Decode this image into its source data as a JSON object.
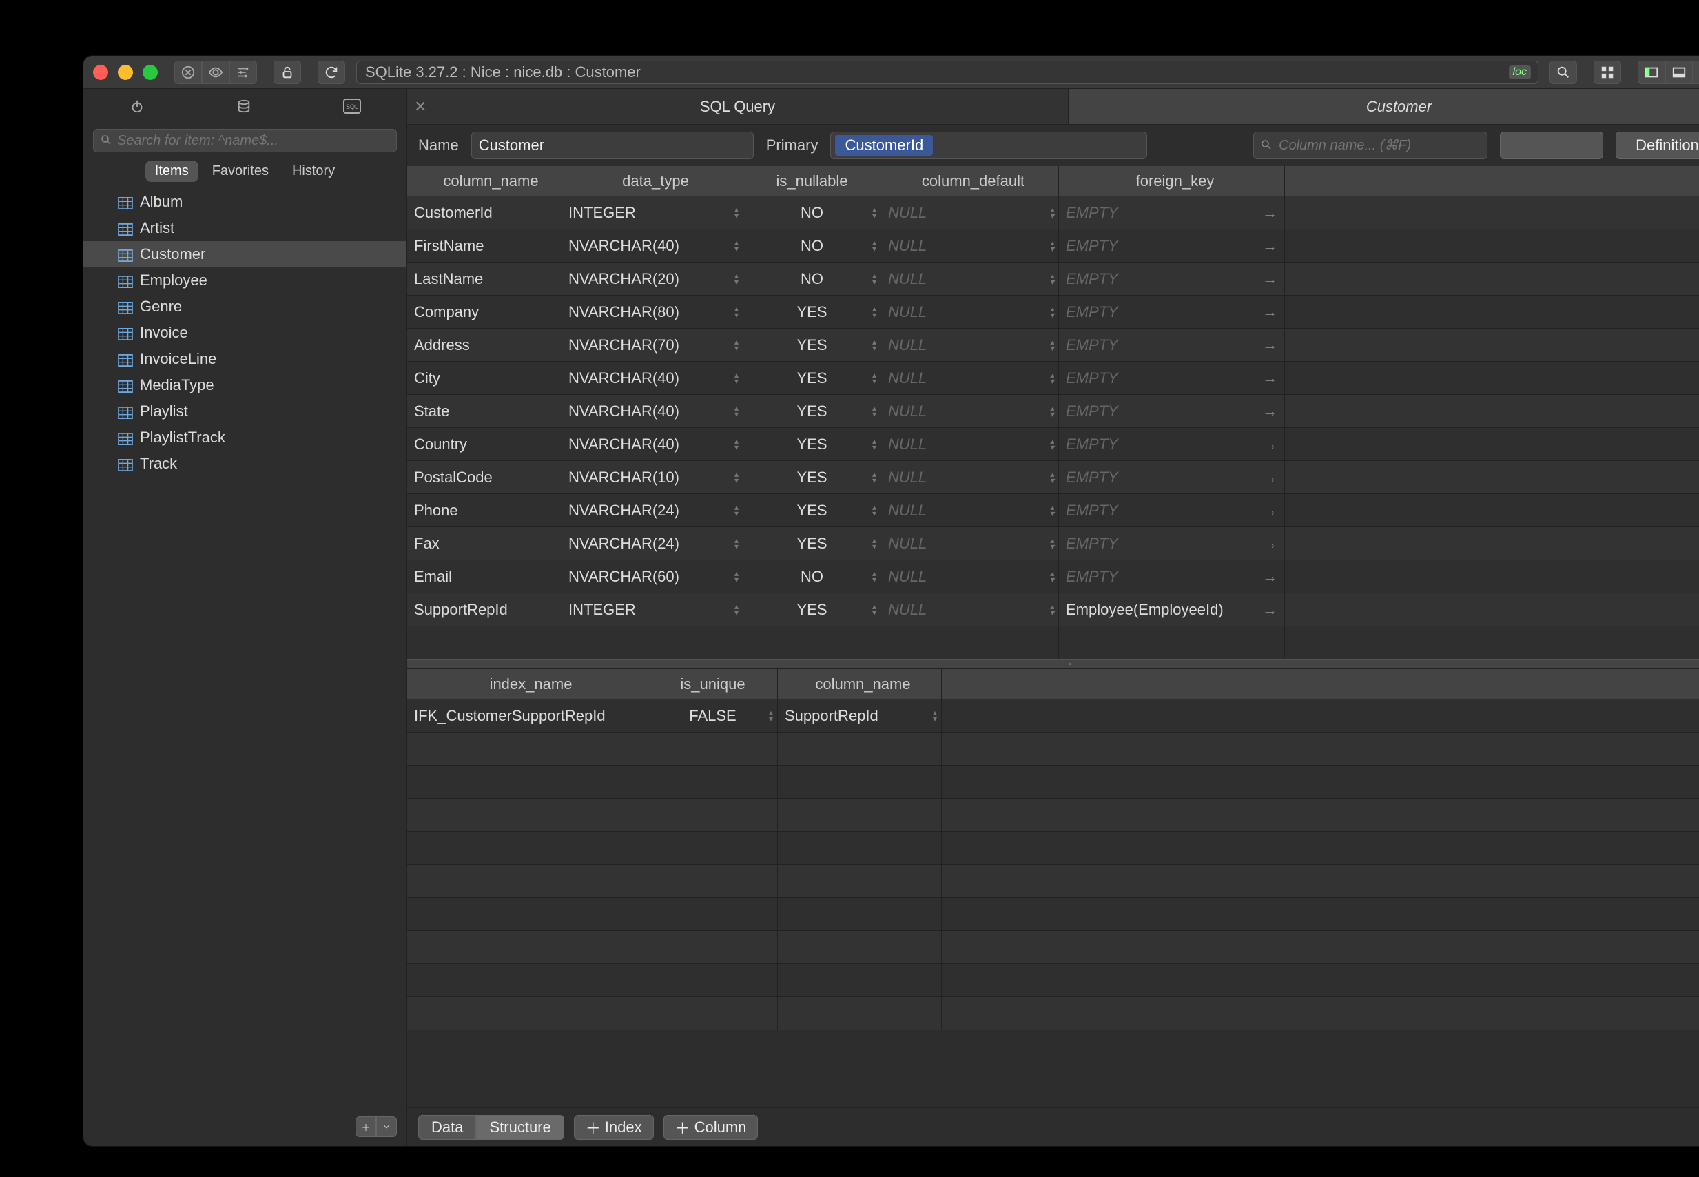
{
  "titlebar": {
    "path": "SQLite 3.27.2 : Nice : nice.db : Customer",
    "loc_tag": "loc"
  },
  "main_tabs": [
    {
      "label": "SQL Query",
      "closable": true,
      "active": false
    },
    {
      "label": "Customer",
      "closable": false,
      "active": true
    }
  ],
  "sidebar": {
    "search_placeholder": "Search for item: ^name$...",
    "filter_tabs": [
      "Items",
      "Favorites",
      "History"
    ],
    "filter_active": 0,
    "items": [
      "Album",
      "Artist",
      "Customer",
      "Employee",
      "Genre",
      "Invoice",
      "InvoiceLine",
      "MediaType",
      "Playlist",
      "PlaylistTrack",
      "Track"
    ],
    "selected": "Customer"
  },
  "table_editor": {
    "name_label": "Name",
    "name_value": "Customer",
    "primary_label": "Primary",
    "primary_key": "CustomerId",
    "column_search_placeholder": "Column name... (⌘F)",
    "definition_label": "Definition"
  },
  "columns_header": [
    "column_name",
    "data_type",
    "is_nullable",
    "column_default",
    "foreign_key"
  ],
  "columns": [
    {
      "name": "CustomerId",
      "type": "INTEGER",
      "nullable": "NO",
      "default": "NULL",
      "fk": "EMPTY",
      "fk_ghost": true
    },
    {
      "name": "FirstName",
      "type": "NVARCHAR(40)",
      "nullable": "NO",
      "default": "NULL",
      "fk": "EMPTY",
      "fk_ghost": true
    },
    {
      "name": "LastName",
      "type": "NVARCHAR(20)",
      "nullable": "NO",
      "default": "NULL",
      "fk": "EMPTY",
      "fk_ghost": true
    },
    {
      "name": "Company",
      "type": "NVARCHAR(80)",
      "nullable": "YES",
      "default": "NULL",
      "fk": "EMPTY",
      "fk_ghost": true
    },
    {
      "name": "Address",
      "type": "NVARCHAR(70)",
      "nullable": "YES",
      "default": "NULL",
      "fk": "EMPTY",
      "fk_ghost": true
    },
    {
      "name": "City",
      "type": "NVARCHAR(40)",
      "nullable": "YES",
      "default": "NULL",
      "fk": "EMPTY",
      "fk_ghost": true
    },
    {
      "name": "State",
      "type": "NVARCHAR(40)",
      "nullable": "YES",
      "default": "NULL",
      "fk": "EMPTY",
      "fk_ghost": true
    },
    {
      "name": "Country",
      "type": "NVARCHAR(40)",
      "nullable": "YES",
      "default": "NULL",
      "fk": "EMPTY",
      "fk_ghost": true
    },
    {
      "name": "PostalCode",
      "type": "NVARCHAR(10)",
      "nullable": "YES",
      "default": "NULL",
      "fk": "EMPTY",
      "fk_ghost": true
    },
    {
      "name": "Phone",
      "type": "NVARCHAR(24)",
      "nullable": "YES",
      "default": "NULL",
      "fk": "EMPTY",
      "fk_ghost": true
    },
    {
      "name": "Fax",
      "type": "NVARCHAR(24)",
      "nullable": "YES",
      "default": "NULL",
      "fk": "EMPTY",
      "fk_ghost": true
    },
    {
      "name": "Email",
      "type": "NVARCHAR(60)",
      "nullable": "NO",
      "default": "NULL",
      "fk": "EMPTY",
      "fk_ghost": true
    },
    {
      "name": "SupportRepId",
      "type": "INTEGER",
      "nullable": "YES",
      "default": "NULL",
      "fk": "Employee(EmployeeId)",
      "fk_ghost": false
    }
  ],
  "index_header": [
    "index_name",
    "is_unique",
    "column_name"
  ],
  "indexes": [
    {
      "name": "IFK_CustomerSupportRepId",
      "unique": "FALSE",
      "column": "SupportRepId"
    }
  ],
  "footer": {
    "data_label": "Data",
    "structure_label": "Structure",
    "index_label": "Index",
    "column_label": "Column"
  }
}
